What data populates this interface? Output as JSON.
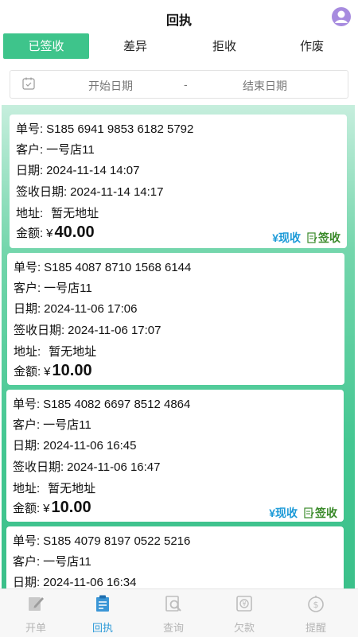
{
  "header": {
    "title": "回执"
  },
  "tabs": [
    {
      "label": "已签收",
      "active": true
    },
    {
      "label": "差异"
    },
    {
      "label": "拒收"
    },
    {
      "label": "作废"
    }
  ],
  "date_range": {
    "start": "开始日期",
    "separator": "-",
    "end": "结束日期"
  },
  "labels": {
    "order": "单号:",
    "customer": "客户:",
    "date": "日期:",
    "signed_date": "签收日期:",
    "address": "地址:",
    "amount": "金额:",
    "currency": "¥",
    "cash_action": "¥现收",
    "sign_action": "签收"
  },
  "receipts": [
    {
      "order_no": "S185 6941 9853 6182 5792",
      "customer": "一号店11",
      "date": "2024-11-14 14:07",
      "signed_date": "2024-11-14 14:17",
      "address": "暂无地址",
      "amount": "40.00"
    },
    {
      "order_no": "S185 4087 8710 1568 6144",
      "customer": "一号店11",
      "date": "2024-11-06 17:06",
      "signed_date": "2024-11-06 17:07",
      "address": "暂无地址",
      "amount": "10.00"
    },
    {
      "order_no": "S185 4082 6697 8512 4864",
      "customer": "一号店11",
      "date": "2024-11-06 16:45",
      "signed_date": "2024-11-06 16:47",
      "address": "暂无地址",
      "amount": "10.00"
    },
    {
      "order_no": "S185 4079 8197 0522 5216",
      "customer": "一号店11",
      "date": "2024-11-06 16:34"
    }
  ],
  "bottom_nav": [
    {
      "label": "开单",
      "icon": "edit-icon"
    },
    {
      "label": "回执",
      "icon": "receipt-icon",
      "active": true
    },
    {
      "label": "查询",
      "icon": "search-doc-icon"
    },
    {
      "label": "欠款",
      "icon": "debt-icon"
    },
    {
      "label": "提醒",
      "icon": "reminder-icon"
    }
  ],
  "colors": {
    "accent": "#3ec48b",
    "link_blue": "#1e9bd8",
    "sign_green": "#3a8a2a",
    "avatar": "#a78bdf"
  }
}
